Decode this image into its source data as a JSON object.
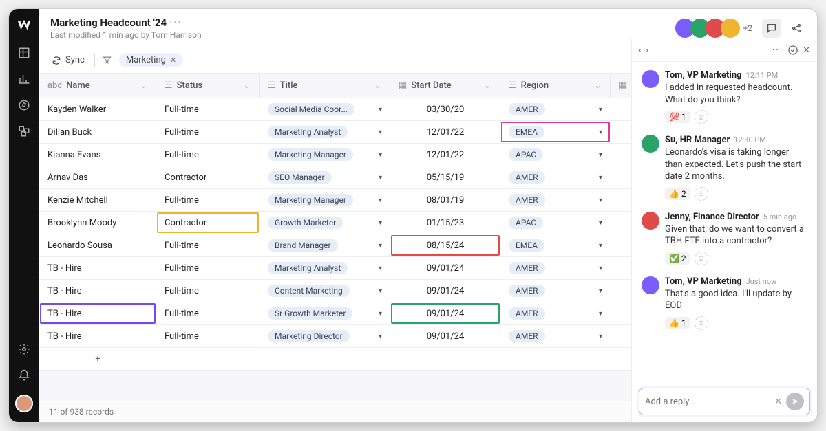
{
  "header": {
    "title": "Marketing Headcount '24",
    "subtitle": "Last modified 1 min ago by Tom Harrison",
    "avatar_overflow": "+2"
  },
  "toolbar": {
    "sync_label": "Sync",
    "filter_chip": "Marketing"
  },
  "columns": {
    "name": "Name",
    "status": "Status",
    "title": "Title",
    "start_date": "Start Date",
    "region": "Region"
  },
  "rows": [
    {
      "name": "Kayden Walker",
      "status": "Full-time",
      "title": "Social Media Coor...",
      "date": "03/30/20",
      "region": "AMER",
      "boxes": {}
    },
    {
      "name": "Dillan Buck",
      "status": "Full-time",
      "title": "Marketing Analyst",
      "date": "12/01/22",
      "region": "EMEA",
      "boxes": {
        "region": "pink"
      }
    },
    {
      "name": "Kianna Evans",
      "status": "Full-time",
      "title": "Marketing Manager",
      "date": "12/01/22",
      "region": "APAC",
      "boxes": {}
    },
    {
      "name": "Arnav Das",
      "status": "Contractor",
      "title": "SEO Manager",
      "date": "05/15/19",
      "region": "AMER",
      "boxes": {}
    },
    {
      "name": "Kenzie Mitchell",
      "status": "Full-time",
      "title": "Marketing Manager",
      "date": "08/01/19",
      "region": "AMER",
      "boxes": {}
    },
    {
      "name": "Brooklynn Moody",
      "status": "Contractor",
      "title": "Growth Marketer",
      "date": "01/15/23",
      "region": "APAC",
      "boxes": {
        "status": "yellow"
      }
    },
    {
      "name": "Leonardo Sousa",
      "status": "Full-time",
      "title": "Brand Manager",
      "date": "08/15/24",
      "region": "EMEA",
      "boxes": {
        "date": "red"
      }
    },
    {
      "name": "TB - Hire",
      "status": "Full-time",
      "title": "Marketing Analyst",
      "date": "09/01/24",
      "region": "AMER",
      "boxes": {}
    },
    {
      "name": "TB - Hire",
      "status": "Full-time",
      "title": "Content Marketing",
      "date": "09/01/24",
      "region": "AMER",
      "boxes": {}
    },
    {
      "name": "TB - Hire",
      "status": "Full-time",
      "title": "Sr Growth Marketer",
      "date": "09/01/24",
      "region": "AMER",
      "boxes": {
        "name": "purple",
        "date": "green"
      }
    },
    {
      "name": "TB - Hire",
      "status": "Full-time",
      "title": "Marketing Director",
      "date": "09/01/24",
      "region": "AMER",
      "boxes": {}
    }
  ],
  "footer": {
    "records": "11 of 938 records"
  },
  "chat": {
    "comments": [
      {
        "author": "Tom, VP Marketing",
        "time": "12:11 PM",
        "text": "I added in requested headcount. What do you think?",
        "react": {
          "emoji": "💯",
          "count": "1"
        }
      },
      {
        "author": "Su, HR Manager",
        "time": "12:30 PM",
        "text": "Leonardo's visa is taking longer than expected. Let's push the start date 2 months.",
        "react": {
          "emoji": "👍",
          "count": "2"
        }
      },
      {
        "author": "Jenny, Finance Director",
        "time": "5 min ago",
        "text": "Given that, do we want to convert a TBH FTE into a contractor?",
        "react": {
          "emoji": "✅",
          "count": "2"
        }
      },
      {
        "author": "Tom, VP Marketing",
        "time": "Just now",
        "text": "That's a good idea. I'll update by EOD",
        "react": {
          "emoji": "👍",
          "count": "1"
        }
      }
    ],
    "reply_placeholder": "Add a reply..."
  }
}
